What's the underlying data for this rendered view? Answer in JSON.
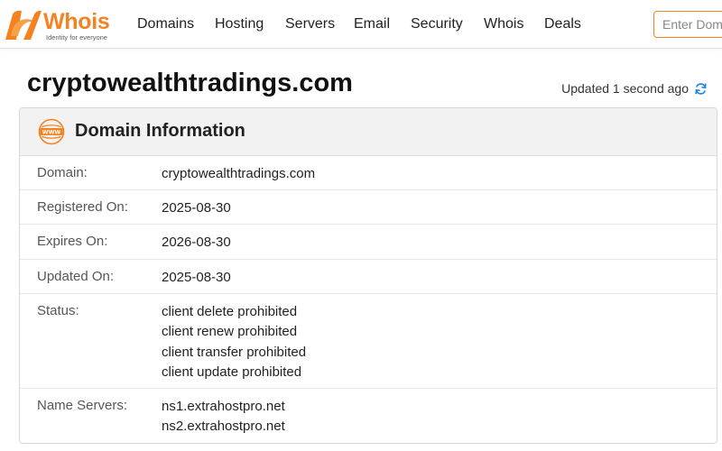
{
  "nav": {
    "brand": "Whois",
    "tagline": "Identity for everyone",
    "links": [
      "Domains",
      "Hosting",
      "Servers",
      "Email",
      "Security",
      "Whois",
      "Deals"
    ],
    "search_placeholder": "Enter Domain"
  },
  "page": {
    "title": "cryptowealthtradings.com",
    "updated": "Updated 1 second ago"
  },
  "card": {
    "title": "Domain Information",
    "icon_text": "WWW",
    "rows": [
      {
        "label": "Domain:",
        "values": [
          "cryptowealthtradings.com"
        ]
      },
      {
        "label": "Registered On:",
        "values": [
          "2025-08-30"
        ]
      },
      {
        "label": "Expires On:",
        "values": [
          "2026-08-30"
        ]
      },
      {
        "label": "Updated On:",
        "values": [
          "2025-08-30"
        ]
      },
      {
        "label": "Status:",
        "values": [
          "client delete prohibited",
          "client renew prohibited",
          "client transfer prohibited",
          "client update prohibited"
        ]
      },
      {
        "label": "Name Servers:",
        "values": [
          "ns1.extrahostpro.net",
          "ns2.extrahostpro.net"
        ]
      }
    ]
  },
  "colors": {
    "brand_orange": "#f58220",
    "refresh_blue": "#1e88e5"
  },
  "icons": {
    "logo": "whois-logo-icon",
    "www": "www-icon",
    "refresh": "refresh-icon"
  }
}
